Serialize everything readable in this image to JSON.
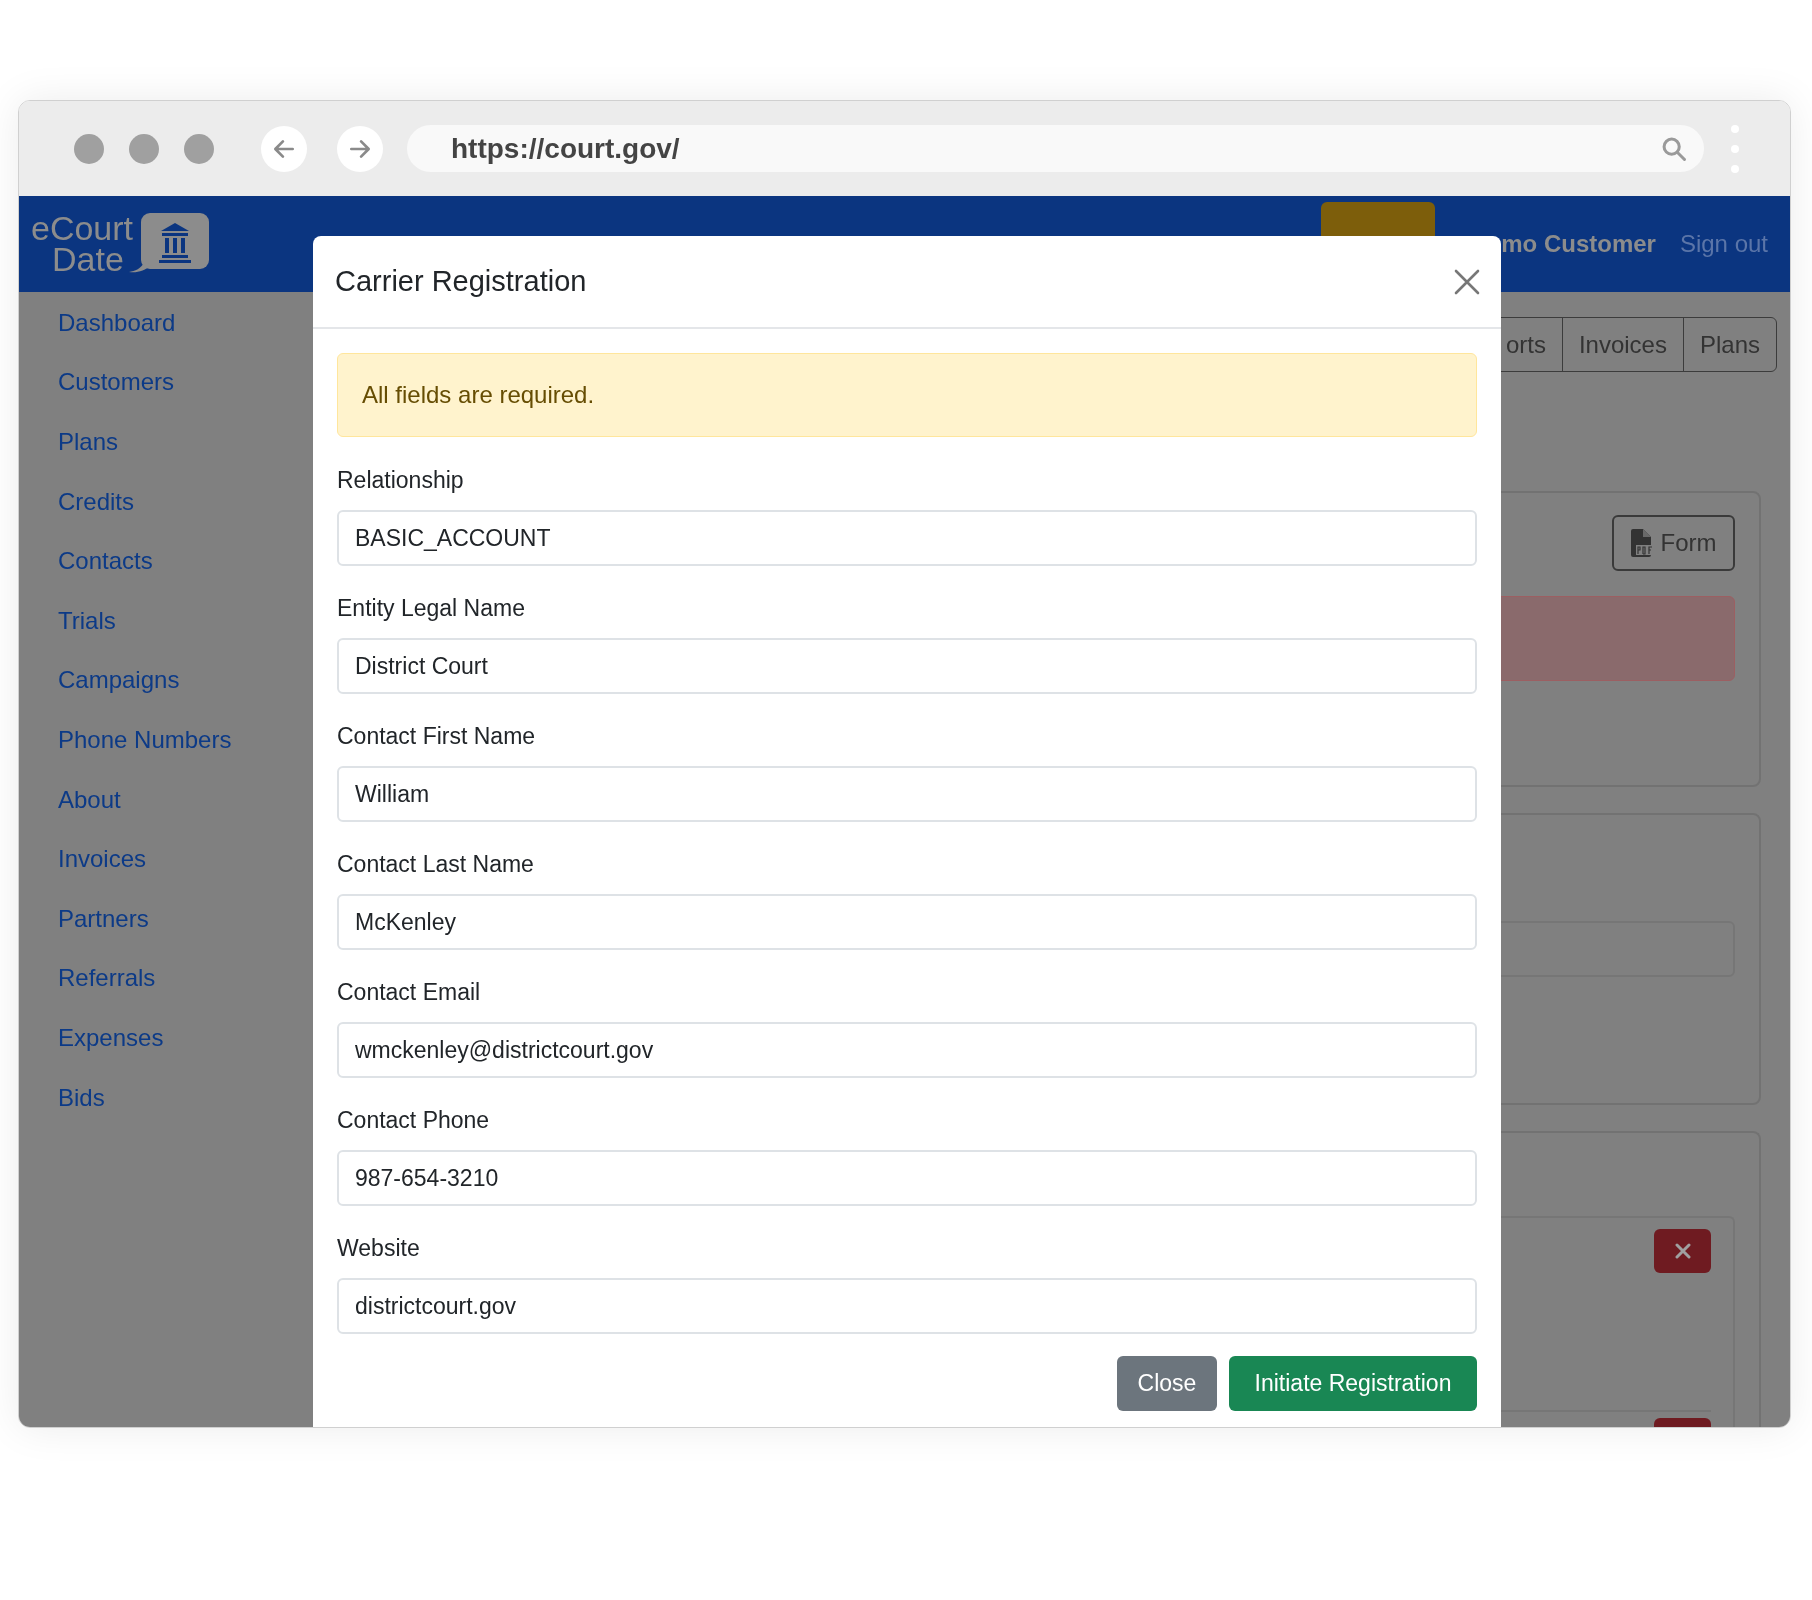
{
  "browser": {
    "url": "https://court.gov/"
  },
  "header": {
    "logo": {
      "line_1": "eCourt",
      "line_2": "Date"
    },
    "user": "mo Customer",
    "sign_out": "Sign out"
  },
  "sidebar": {
    "items": [
      "Dashboard",
      "Customers",
      "Plans",
      "Credits",
      "Contacts",
      "Trials",
      "Campaigns",
      "Phone Numbers",
      "About",
      "Invoices",
      "Partners",
      "Referrals",
      "Expenses",
      "Bids"
    ]
  },
  "background": {
    "tabs": [
      "orts",
      "Invoices",
      "Plans"
    ],
    "form_button": "Form"
  },
  "modal": {
    "title": "Carrier Registration",
    "alert": "All fields are required.",
    "fields": [
      {
        "label": "Relationship",
        "value": "BASIC_ACCOUNT"
      },
      {
        "label": "Entity Legal Name",
        "value": "District Court"
      },
      {
        "label": "Contact First Name",
        "value": "William"
      },
      {
        "label": "Contact Last Name",
        "value": "McKenley"
      },
      {
        "label": "Contact Email",
        "value": "wmckenley@districtcourt.gov"
      },
      {
        "label": "Contact Phone",
        "value": "987-654-3210"
      },
      {
        "label": "Website",
        "value": "districtcourt.gov"
      }
    ],
    "buttons": [
      {
        "label": "Close",
        "kind": "secondary"
      },
      {
        "label": "Initiate Registration",
        "kind": "primary"
      }
    ]
  }
}
